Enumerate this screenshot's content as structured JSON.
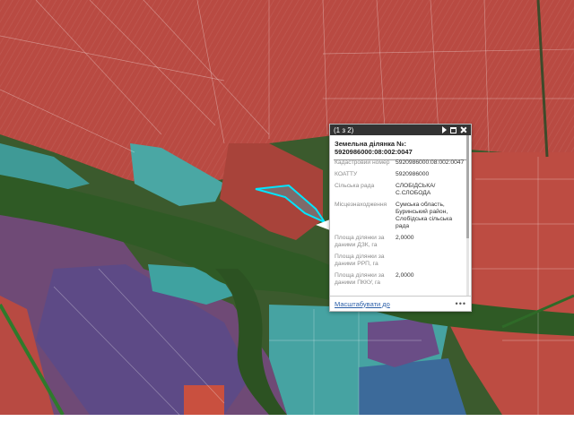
{
  "map": {
    "colors": {
      "parcel_red": "#c9423f",
      "parcel_purple": "#6e4a78",
      "parcel_teal": "#4aa7a4",
      "highlight": "#00e5ff",
      "vegetation": "#2f5a25"
    }
  },
  "popup": {
    "counter": "(1 з 2)",
    "controls": [
      "play-icon",
      "maximize-icon",
      "close-icon"
    ],
    "title_line1": "Земельна ділянка №:",
    "title_line2": "5920986000:08:002:0047",
    "rows": [
      {
        "label": "Кадастровий номер",
        "value": "5920986000:08:002:0047"
      },
      {
        "label": "КОАТТУ",
        "value": "5920986000"
      },
      {
        "label": "Сільська рада",
        "value": "СЛОБІДСЬКА/ С.СЛОБОДА"
      },
      {
        "label": "Місцезнаходження",
        "value": "Сумська область, Буринський район, Слобідська сільська рада"
      },
      {
        "label": "Площа ділянки за даними ДЗК, га",
        "value": "2,0000"
      },
      {
        "label": "Площа ділянки за даними РРП, га",
        "value": ""
      },
      {
        "label": "Площа ділянки за даними ПККУ, га",
        "value": "2,0000"
      }
    ],
    "zoom_link": "Масштабувати до",
    "more": "•••"
  }
}
